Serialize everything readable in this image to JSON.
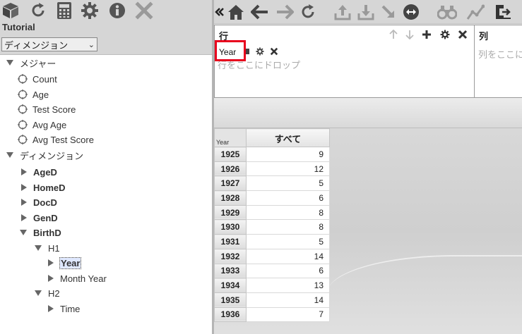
{
  "left_toolbar": {
    "icons": [
      "cube-icon",
      "refresh-icon",
      "calculator-icon",
      "gear-icon",
      "info-icon",
      "close-icon"
    ]
  },
  "cube": {
    "title": "Tutorial",
    "selected": "ディメンジョン"
  },
  "tree": {
    "measures_label": "メジャー",
    "measures": [
      "Count",
      "Age",
      "Test Score",
      "Avg Age",
      "Avg Test Score"
    ],
    "dimensions_label": "ディメンジョン",
    "dimensions": [
      "AgeD",
      "HomeD",
      "DocD",
      "GenD",
      "BirthD"
    ],
    "hierarchies": [
      {
        "label": "H1",
        "levels": [
          "Year",
          "Month Year"
        ]
      },
      {
        "label": "H2",
        "levels": [
          "Time"
        ]
      }
    ]
  },
  "right_toolbar": {
    "icons": [
      "collapse-icon",
      "home-icon",
      "back-arrow-icon",
      "forward-arrow-icon",
      "redo-icon",
      "upload-icon",
      "download-icon",
      "drill-icon",
      "swap-icon",
      "binoculars-icon",
      "chart-icon",
      "export-icon"
    ]
  },
  "rows_panel": {
    "label": "行",
    "chip": "Year",
    "drop_hint": "行をここにドロップ"
  },
  "cols_panel": {
    "label": "列",
    "drop_hint": "列をここにドロップ"
  },
  "table": {
    "corner_label": "Year",
    "column_header": "すべて",
    "rows": [
      {
        "year": "1925",
        "value": "9"
      },
      {
        "year": "1926",
        "value": "12"
      },
      {
        "year": "1927",
        "value": "5"
      },
      {
        "year": "1928",
        "value": "6"
      },
      {
        "year": "1929",
        "value": "8"
      },
      {
        "year": "1930",
        "value": "8"
      },
      {
        "year": "1931",
        "value": "5"
      },
      {
        "year": "1932",
        "value": "14"
      },
      {
        "year": "1933",
        "value": "6"
      },
      {
        "year": "1934",
        "value": "13"
      },
      {
        "year": "1935",
        "value": "14"
      },
      {
        "year": "1936",
        "value": "7"
      }
    ]
  }
}
